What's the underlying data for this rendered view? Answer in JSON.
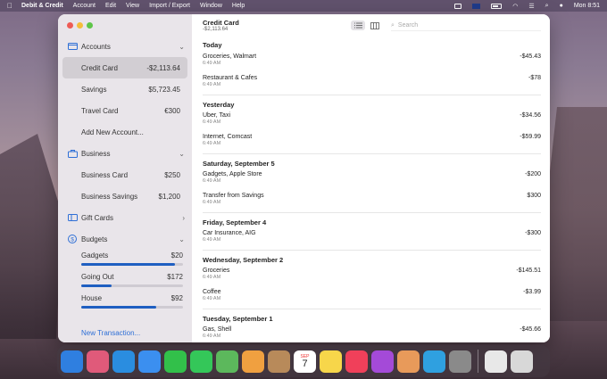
{
  "menubar": {
    "apple_icon": "apple-icon",
    "app_name": "Debit & Credit",
    "items": [
      "Account",
      "Edit",
      "View",
      "Import / Export",
      "Window",
      "Help"
    ],
    "clock": "Mon 8:51"
  },
  "sidebar": {
    "sections": {
      "accounts": {
        "label": "Accounts",
        "icon": "credit-card-icon"
      },
      "business": {
        "label": "Business",
        "icon": "briefcase-icon"
      },
      "gift_cards": {
        "label": "Gift Cards",
        "icon": "gift-card-icon"
      },
      "budgets": {
        "label": "Budgets",
        "icon": "dollar-circle-icon"
      }
    },
    "accounts": [
      {
        "label": "Credit Card",
        "value": "-$2,113.64"
      },
      {
        "label": "Savings",
        "value": "$5,723.45"
      },
      {
        "label": "Travel Card",
        "value": "€300"
      },
      {
        "label": "Add New Account...",
        "value": ""
      }
    ],
    "business": [
      {
        "label": "Business Card",
        "value": "$250"
      },
      {
        "label": "Business Savings",
        "value": "$1,200"
      }
    ],
    "budgets": [
      {
        "label": "Gadgets",
        "value": "$20",
        "progress": 0.92
      },
      {
        "label": "Going Out",
        "value": "$172",
        "progress": 0.3
      },
      {
        "label": "House",
        "value": "$92",
        "progress": 0.74
      }
    ],
    "new_transaction": "New Transaction..."
  },
  "toolbar": {
    "title": "Credit Card",
    "subtitle": "-$2,113.64",
    "search_placeholder": "Search"
  },
  "days": [
    {
      "heading": "Today",
      "items": [
        {
          "name": "Groceries, Walmart",
          "time": "6:49 AM",
          "amount": "-$45.43"
        },
        {
          "name": "Restaurant & Cafes",
          "time": "6:49 AM",
          "amount": "-$78"
        }
      ]
    },
    {
      "heading": "Yesterday",
      "items": [
        {
          "name": "Uber, Taxi",
          "time": "6:49 AM",
          "amount": "-$34.56"
        },
        {
          "name": "Internet, Comcast",
          "time": "6:49 AM",
          "amount": "-$59.99"
        }
      ]
    },
    {
      "heading": "Saturday, September 5",
      "items": [
        {
          "name": "Gadgets, Apple Store",
          "time": "6:49 AM",
          "amount": "-$200"
        },
        {
          "name": "Transfer from Savings",
          "time": "6:49 AM",
          "amount": "$300"
        }
      ]
    },
    {
      "heading": "Friday, September 4",
      "items": [
        {
          "name": "Car Insurance, AIG",
          "time": "6:49 AM",
          "amount": "-$300"
        }
      ]
    },
    {
      "heading": "Wednesday, September 2",
      "items": [
        {
          "name": "Groceries",
          "time": "6:49 AM",
          "amount": "-$145.51"
        },
        {
          "name": "Coffee",
          "time": "6:49 AM",
          "amount": "-$3.99"
        }
      ]
    },
    {
      "heading": "Tuesday, September 1",
      "items": [
        {
          "name": "Gas, Shell",
          "time": "6:49 AM",
          "amount": "-$45.66"
        }
      ]
    }
  ],
  "dock": {
    "apps": [
      {
        "name": "finder-icon",
        "color": "#2f7fe0"
      },
      {
        "name": "launchpad-icon",
        "color": "#e05a7a"
      },
      {
        "name": "safari-icon",
        "color": "#2a8de0"
      },
      {
        "name": "mail-icon",
        "color": "#3b8ff0"
      },
      {
        "name": "facetime-icon",
        "color": "#32c04a"
      },
      {
        "name": "messages-icon",
        "color": "#34c759"
      },
      {
        "name": "maps-icon",
        "color": "#5cb85c"
      },
      {
        "name": "photos-icon",
        "color": "#f0a040"
      },
      {
        "name": "contacts-icon",
        "color": "#b88a5a"
      },
      {
        "name": "calendar-icon",
        "color": "#ffffff",
        "month": "SEP",
        "day": "7"
      },
      {
        "name": "notes-icon",
        "color": "#f7d64a"
      },
      {
        "name": "music-icon",
        "color": "#f0405a"
      },
      {
        "name": "podcasts-icon",
        "color": "#a44ad8"
      },
      {
        "name": "debit-credit-icon",
        "color": "#e89a5a"
      },
      {
        "name": "finder-smile-icon",
        "color": "#2fa0e0"
      },
      {
        "name": "system-preferences-icon",
        "color": "#8a8a8a"
      }
    ],
    "after_sep": [
      {
        "name": "document-icon",
        "color": "#e8e8e8"
      },
      {
        "name": "trash-icon",
        "color": "#d8d8d8"
      }
    ]
  }
}
